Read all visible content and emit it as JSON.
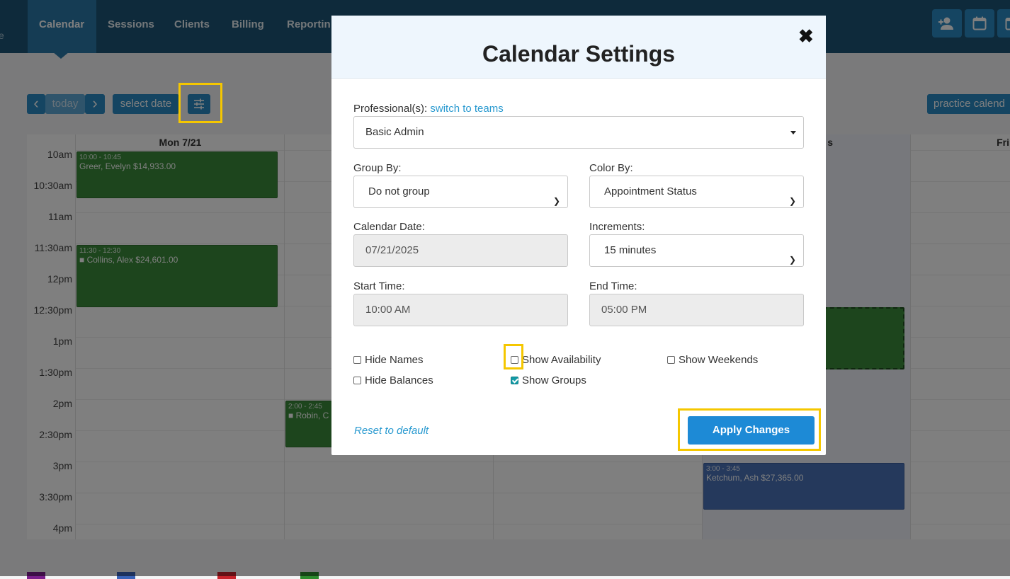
{
  "nav": {
    "brand_fragment": "e",
    "items": [
      {
        "label": "Calendar",
        "active": true
      },
      {
        "label": "Sessions"
      },
      {
        "label": "Clients"
      },
      {
        "label": "Billing"
      },
      {
        "label": "Reportin"
      }
    ],
    "right_icons": [
      "add-client-icon",
      "calendar-icon",
      "calendar-icon"
    ]
  },
  "toolbar": {
    "prev": "‹",
    "today": "today",
    "next": "›",
    "select_date": "select date",
    "settings_icon": "sliders-icon",
    "practice_calendar": "practice calend"
  },
  "calendar": {
    "days": [
      "Mon 7/21",
      "",
      "",
      "s",
      "Fri"
    ],
    "times": [
      "10am",
      "10:30am",
      "11am",
      "11:30am",
      "12pm",
      "12:30pm",
      "1pm",
      "1:30pm",
      "2pm",
      "2:30pm",
      "3pm",
      "3:30pm",
      "4pm"
    ],
    "events": [
      {
        "time": "10:00 - 10:45",
        "title": "Greer, Evelyn $14,933.00",
        "video": false
      },
      {
        "time": "11:30 - 12:30",
        "title": "Collins, Alex $24,601.00",
        "video": true
      },
      {
        "time": "2:00 - 2:45",
        "title": "Robin, C",
        "video": true
      },
      {
        "time": "3:00 - 3:45",
        "title": "Ketchum, Ash $27,365.00",
        "video": false
      }
    ]
  },
  "modal": {
    "title": "Calendar Settings",
    "professionals_label": "Professional(s):",
    "switch_link": "switch to teams",
    "professional_value": "Basic Admin",
    "group_by_label": "Group By:",
    "group_by_value": "Do not group",
    "color_by_label": "Color By:",
    "color_by_value": "Appointment Status",
    "calendar_date_label": "Calendar Date:",
    "calendar_date_value": "07/21/2025",
    "increments_label": "Increments:",
    "increments_value": "15 minutes",
    "start_time_label": "Start Time:",
    "start_time_value": "10:00 AM",
    "end_time_label": "End Time:",
    "end_time_value": "05:00 PM",
    "checkboxes": [
      {
        "label": "Hide Names",
        "checked": false
      },
      {
        "label": "Show Availability",
        "checked": false
      },
      {
        "label": "Show Weekends",
        "checked": false
      },
      {
        "label": "Hide Balances",
        "checked": false
      },
      {
        "label": "Show Groups",
        "checked": true
      }
    ],
    "reset_label": "Reset to default",
    "apply_label": "Apply Changes"
  },
  "colors": {
    "nav_bg": "#1d5576",
    "accent": "#2a8ac4",
    "event_green": "#3a8a3a",
    "event_blue": "#4a72b8",
    "highlight": "#f5c700",
    "checkbox_checked": "#139ba6",
    "legend_swatches": [
      "#7b1f8c",
      "#3a63b8",
      "#c8232c",
      "#2e8b2e"
    ]
  }
}
